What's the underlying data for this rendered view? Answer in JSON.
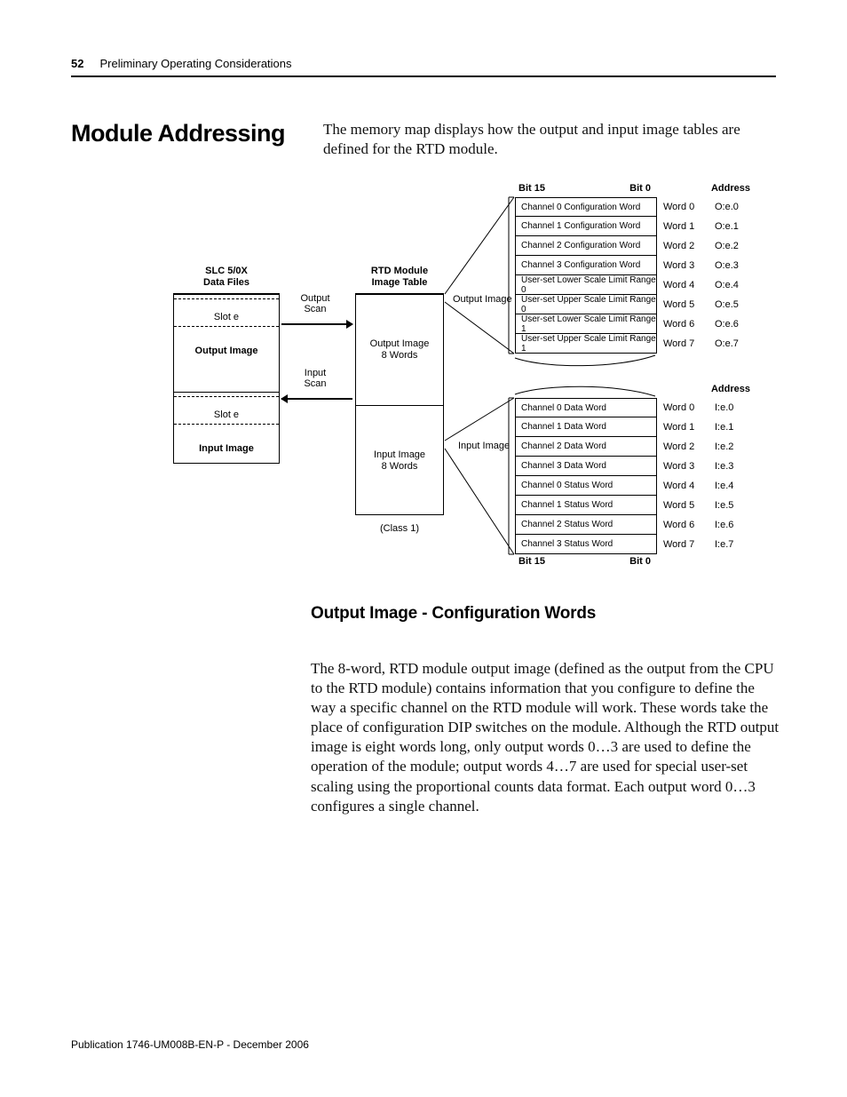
{
  "header": {
    "page_number": "52",
    "running_title": "Preliminary Operating Considerations"
  },
  "section": {
    "title": "Module Addressing",
    "intro": "The memory map displays how the output and input image tables are defined for the RTD module."
  },
  "subsection": {
    "title": "Output Image - Configuration Words",
    "body": "The 8-word, RTD module output image (defined as the output from the CPU to the RTD module) contains information that you configure to define the way a specific channel on the RTD module will work. These words take the place of configuration DIP switches on the module. Although the RTD output image is eight words long, only output words 0…3 are used to define the operation of the module; output words 4…7 are used for special user-set scaling using the proportional counts data format. Each output word 0…3 configures a single channel."
  },
  "diagram": {
    "left_heading": "SLC 5/0X\nData Files",
    "mid_heading": "RTD Module\nImage Table",
    "left_blocks": [
      {
        "slot": "Slot e",
        "label": "Output Image"
      },
      {
        "slot": "Slot e",
        "label": "Input Image"
      }
    ],
    "mid_blocks": [
      "Output Image\n8 Words",
      "Input Image\n8 Words"
    ],
    "class_note": "(Class 1)",
    "scans": {
      "out": "Output\nScan",
      "in": "Input\nScan"
    },
    "side_labels": {
      "out": "Output Image",
      "in": "Input Image"
    },
    "bits_top": {
      "hi": "Bit 15",
      "lo": "Bit 0"
    },
    "bits_bottom": {
      "hi": "Bit 15",
      "lo": "Bit 0"
    },
    "address_header": "Address",
    "output_rows": [
      {
        "name": "Channel 0 Configuration Word",
        "word": "Word 0",
        "addr": "O:e.0"
      },
      {
        "name": "Channel 1 Configuration Word",
        "word": "Word 1",
        "addr": "O:e.1"
      },
      {
        "name": "Channel 2 Configuration Word",
        "word": "Word 2",
        "addr": "O:e.2"
      },
      {
        "name": "Channel 3 Configuration Word",
        "word": "Word 3",
        "addr": "O:e.3"
      },
      {
        "name": "User-set Lower Scale Limit Range 0",
        "word": "Word 4",
        "addr": "O:e.4"
      },
      {
        "name": "User-set Upper Scale Limit Range 0",
        "word": "Word 5",
        "addr": "O:e.5"
      },
      {
        "name": "User-set Lower Scale Limit Range 1",
        "word": "Word 6",
        "addr": "O:e.6"
      },
      {
        "name": "User-set Upper Scale Limit Range 1",
        "word": "Word 7",
        "addr": "O:e.7"
      }
    ],
    "input_rows": [
      {
        "name": "Channel 0 Data Word",
        "word": "Word 0",
        "addr": "I:e.0"
      },
      {
        "name": "Channel 1 Data Word",
        "word": "Word 1",
        "addr": "I:e.1"
      },
      {
        "name": "Channel 2 Data Word",
        "word": "Word 2",
        "addr": "I:e.2"
      },
      {
        "name": "Channel 3 Data Word",
        "word": "Word 3",
        "addr": "I:e.3"
      },
      {
        "name": "Channel 0 Status Word",
        "word": "Word 4",
        "addr": "I:e.4"
      },
      {
        "name": "Channel 1 Status Word",
        "word": "Word 5",
        "addr": "I:e.5"
      },
      {
        "name": "Channel 2 Status Word",
        "word": "Word 6",
        "addr": "I:e.6"
      },
      {
        "name": "Channel 3 Status Word",
        "word": "Word 7",
        "addr": "I:e.7"
      }
    ]
  },
  "footer": "Publication 1746-UM008B-EN-P - December 2006"
}
